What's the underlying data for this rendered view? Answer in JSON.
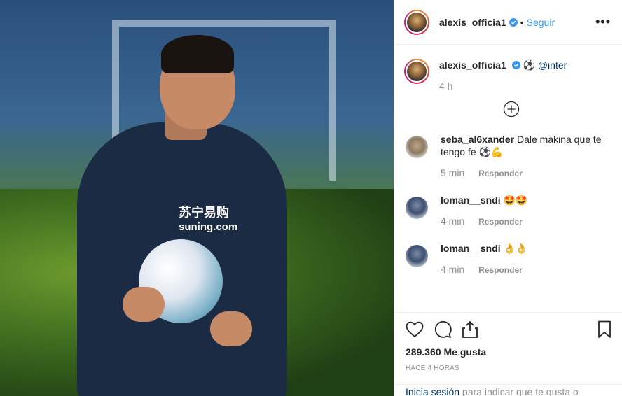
{
  "post": {
    "username": "alexis_officia1",
    "follow_label": "Seguir",
    "more_label": "•••",
    "separator": "•"
  },
  "caption": {
    "username": "alexis_officia1",
    "emoji": "⚽",
    "mention": "@inter",
    "time": "4 h"
  },
  "comments": [
    {
      "username": "seba_al6xander",
      "text": "Dale makina que te tengo fe ⚽💪",
      "time": "5 min",
      "reply_label": "Responder"
    },
    {
      "username": "loman__sndi",
      "text": "🤩🤩",
      "time": "4 min",
      "reply_label": "Responder"
    },
    {
      "username": "loman__sndi",
      "text": "👌👌",
      "time": "4 min",
      "reply_label": "Responder"
    }
  ],
  "actions": {
    "likes": "289.360 Me gusta",
    "posted_ago": "HACE 4 HORAS"
  },
  "login_prompt": {
    "link": "Inicia sesión",
    "text": " para indicar que te gusta o"
  },
  "photo": {
    "sponsor": "suning.com",
    "sponsor_cn": "苏宁易购"
  },
  "colors": {
    "link_blue": "#3897f0",
    "verified": "#3897f0",
    "text": "#262626",
    "muted": "#8e8e8e"
  },
  "icons": [
    "verified-badge-icon",
    "more-options-icon",
    "add-comment-icon",
    "heart-icon",
    "comment-icon",
    "share-icon",
    "bookmark-icon"
  ]
}
